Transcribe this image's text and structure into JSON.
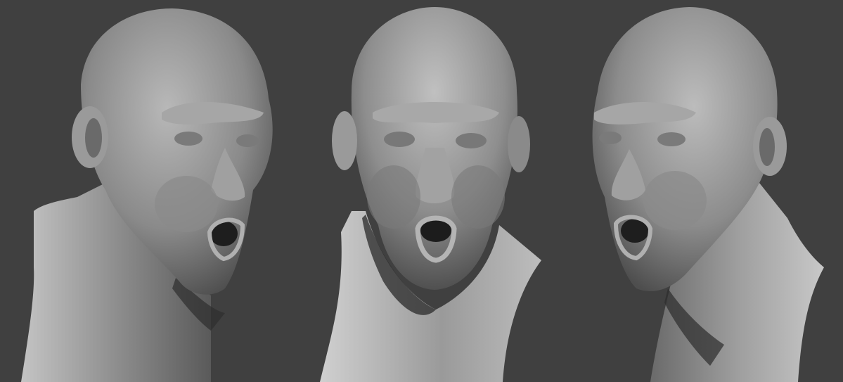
{
  "scene": {
    "background_color": "#404040",
    "subject": "three-view-clay-sculpt-of-bald-head",
    "views": [
      {
        "id": "left-three-quarter",
        "facing": "right"
      },
      {
        "id": "front",
        "facing": "viewer"
      },
      {
        "id": "right-three-quarter",
        "facing": "left"
      }
    ],
    "clay_colors": {
      "highlight": "#cfcfcf",
      "mid": "#9a9a9a",
      "shadow": "#4a4a4a",
      "deep_shadow": "#1e1e1e"
    }
  }
}
